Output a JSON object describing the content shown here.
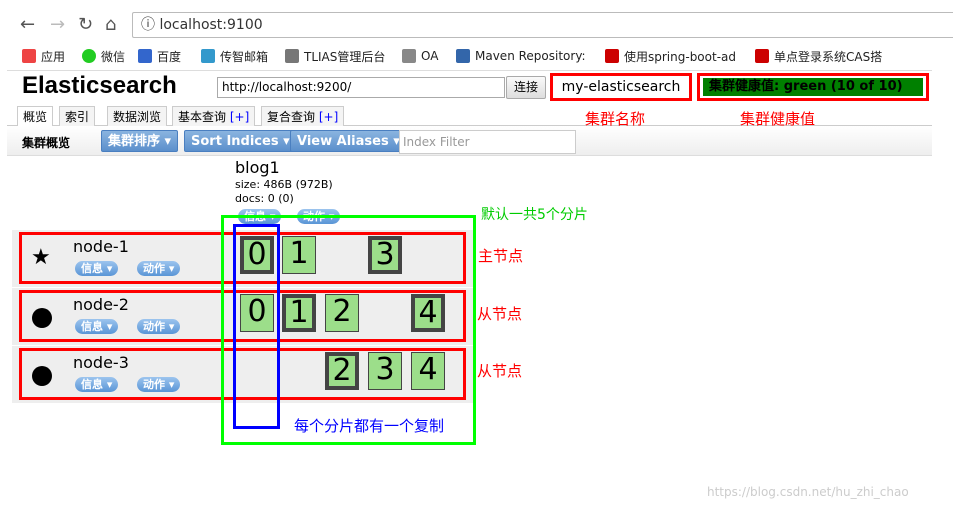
{
  "browser": {
    "url": "localhost:9100",
    "bookmarks": [
      {
        "label": "应用",
        "icon": "apps-grid-icon"
      },
      {
        "label": "微信",
        "icon": "wechat-icon"
      },
      {
        "label": "百度",
        "icon": "baidu-icon"
      },
      {
        "label": "传智邮箱",
        "icon": "mail-icon"
      },
      {
        "label": "TLIAS管理后台",
        "icon": "globe-icon"
      },
      {
        "label": "OA",
        "icon": "oa-icon"
      },
      {
        "label": "Maven Repository:",
        "icon": "maven-icon"
      },
      {
        "label": "使用spring-boot-ad",
        "icon": "csdn-icon"
      },
      {
        "label": "单点登录系统CAS搭",
        "icon": "csdn-icon"
      }
    ]
  },
  "header": {
    "title": "Elasticsearch",
    "url": "http://localhost:9200/",
    "connect": "连接",
    "cluster_name": "my-elasticsearch",
    "health": "集群健康值: green (10 of 10)",
    "health_color": "#008000"
  },
  "tabs": [
    {
      "label": "概览"
    },
    {
      "label": "索引"
    },
    {
      "label": "数据浏览"
    },
    {
      "label": "基本查询",
      "plus": "[+]"
    },
    {
      "label": "复合查询",
      "plus": "[+]"
    }
  ],
  "toolbar": {
    "label": "集群概览",
    "sort_cluster": "集群排序",
    "sort_indices": "Sort Indices",
    "view_aliases": "View Aliases",
    "filter_placeholder": "Index Filter"
  },
  "index": {
    "name": "blog1",
    "size": "size: 486B (972B)",
    "docs": "docs: 0 (0)",
    "info": "信息",
    "action": "动作"
  },
  "nodes": [
    {
      "name": "node-1",
      "icon": "star-icon",
      "info": "信息",
      "action": "动作",
      "shards": [
        {
          "id": "0",
          "primary": true
        },
        {
          "id": "1",
          "primary": false
        },
        {
          "id": "3",
          "primary": true
        }
      ]
    },
    {
      "name": "node-2",
      "icon": "circle-icon",
      "info": "信息",
      "action": "动作",
      "shards": [
        {
          "id": "0",
          "primary": false
        },
        {
          "id": "1",
          "primary": true
        },
        {
          "id": "2",
          "primary": false
        },
        {
          "id": "4",
          "primary": true
        }
      ]
    },
    {
      "name": "node-3",
      "icon": "circle-icon",
      "info": "信息",
      "action": "动作",
      "shards": [
        {
          "id": "2",
          "primary": true
        },
        {
          "id": "3",
          "primary": false
        },
        {
          "id": "4",
          "primary": false
        }
      ]
    }
  ],
  "annotations": {
    "cluster_name": "集群名称",
    "cluster_health": "集群健康值",
    "default_shards": "默认一共5个分片",
    "master": "主节点",
    "slave1": "从节点",
    "slave2": "从节点",
    "replica": "每个分片都有一个复制"
  },
  "watermark": "https://blog.csdn.net/hu_zhi_chao"
}
